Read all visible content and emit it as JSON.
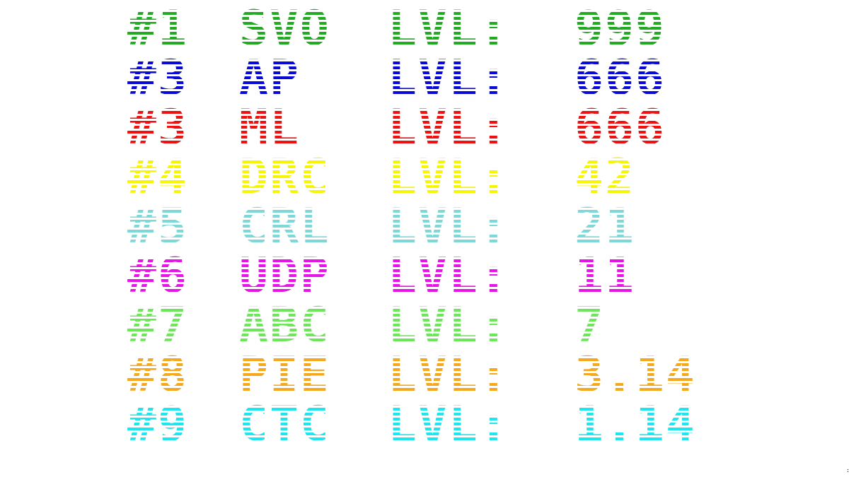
{
  "scoreboard": {
    "level_label": "LVL:",
    "rows": [
      {
        "rank": "#1",
        "name": "SVO",
        "score": "999",
        "color": "#22aa22"
      },
      {
        "rank": "#3",
        "name": "AP",
        "score": "666",
        "color": "#0a0ad6"
      },
      {
        "rank": "#3",
        "name": "ML",
        "score": "666",
        "color": "#ee1111"
      },
      {
        "rank": "#4",
        "name": "DRC",
        "score": "42",
        "color": "#f6f600"
      },
      {
        "rank": "#5",
        "name": "CRL",
        "score": "21",
        "color": "#7ed8d8"
      },
      {
        "rank": "#6",
        "name": "UDP",
        "score": "11",
        "color": "#e614e6"
      },
      {
        "rank": "#7",
        "name": "ABC",
        "score": "7",
        "color": "#6ee65a"
      },
      {
        "rank": "#8",
        "name": "PIE",
        "score": "3.14",
        "color": "#f4a81e"
      },
      {
        "rank": "#9",
        "name": "CTC",
        "score": "1.14",
        "color": "#1ee6ee"
      }
    ]
  }
}
